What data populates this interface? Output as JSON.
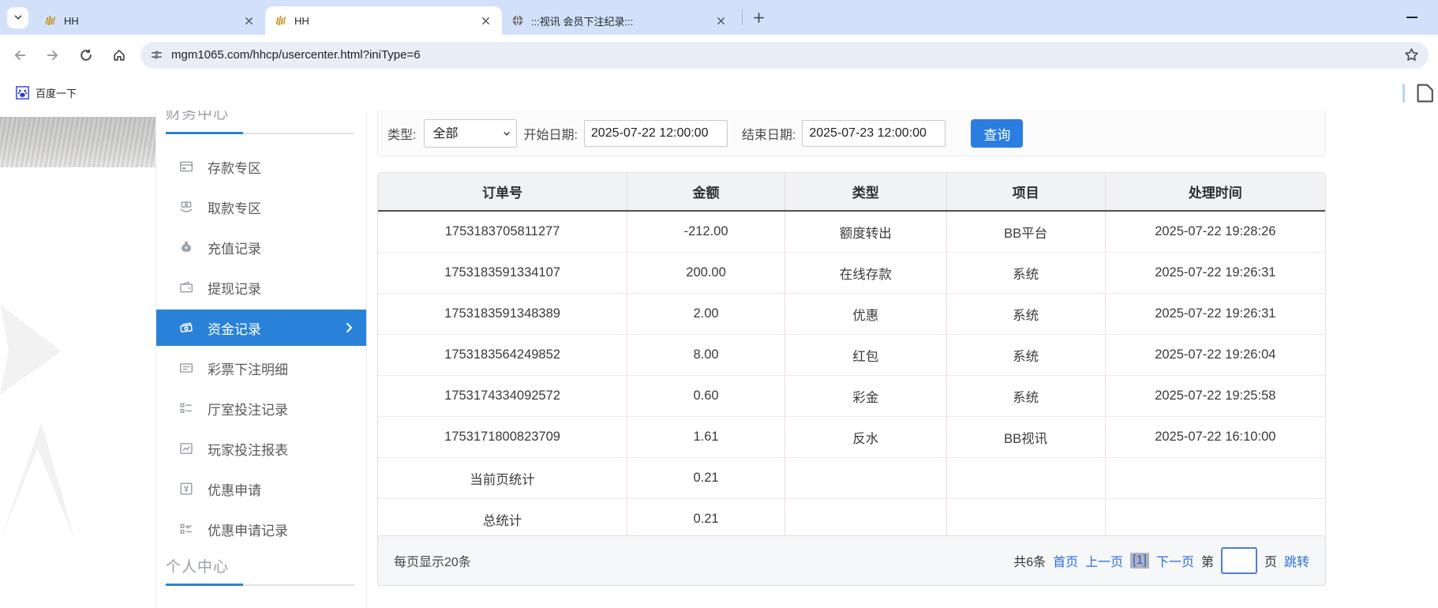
{
  "browser": {
    "tabs": [
      {
        "title": "HH",
        "favicon": "hh-gold-bars-logo"
      },
      {
        "title": "HH",
        "favicon": "hh-gold-bars-logo",
        "active": true
      },
      {
        "title": ":::视讯 会员下注纪录:::",
        "favicon": "globe"
      }
    ],
    "url": "mgm1065.com/hhcp/usercenter.html?iniType=6",
    "bookmarks": [
      {
        "label": "百度一下",
        "icon": "baidu-paw"
      }
    ]
  },
  "icons": {
    "tab_search": "chevron-down",
    "new_tab": "plus",
    "window": "minimize-dash",
    "toolbar": [
      "back-arrow",
      "forward-arrow",
      "reload",
      "home",
      "site-info-tune",
      "bookmark-star"
    ]
  },
  "sidebar": {
    "section_finance": "财务中心",
    "section_personal": "个人中心",
    "items": [
      {
        "label": "存款专区",
        "icon": "deposit-card"
      },
      {
        "label": "取款专区",
        "icon": "withdraw-hand"
      },
      {
        "label": "充值记录",
        "icon": "recharge-moneybag"
      },
      {
        "label": "提现记录",
        "icon": "withdrawal-wallet"
      },
      {
        "label": "资金记录",
        "icon": "funds-banknotes",
        "active": true
      },
      {
        "label": "彩票下注明细",
        "icon": "lottery-list"
      },
      {
        "label": "厅室投注记录",
        "icon": "hall-bet-list"
      },
      {
        "label": "玩家投注报表",
        "icon": "player-report-chart"
      },
      {
        "label": "优惠申请",
        "icon": "promo-apply"
      },
      {
        "label": "优惠申请记录",
        "icon": "promo-record-list"
      }
    ]
  },
  "filters": {
    "type_label": "类型:",
    "type_value": "全部",
    "start_label": "开始日期:",
    "start_value": "2025-07-22 12:00:00",
    "end_label": "结束日期:",
    "end_value": "2025-07-23 12:00:00",
    "search_button": "查询"
  },
  "table": {
    "headers": [
      "订单号",
      "金额",
      "类型",
      "项目",
      "处理时间"
    ],
    "rows": [
      [
        "1753183705811277",
        "-212.00",
        "额度转出",
        "BB平台",
        "2025-07-22 19:28:26"
      ],
      [
        "1753183591334107",
        "200.00",
        "在线存款",
        "系统",
        "2025-07-22 19:26:31"
      ],
      [
        "1753183591348389",
        "2.00",
        "优惠",
        "系统",
        "2025-07-22 19:26:31"
      ],
      [
        "1753183564249852",
        "8.00",
        "红包",
        "系统",
        "2025-07-22 19:26:04"
      ],
      [
        "1753174334092572",
        "0.60",
        "彩金",
        "系统",
        "2025-07-22 19:25:58"
      ],
      [
        "1753171800823709",
        "1.61",
        "反水",
        "BB视讯",
        "2025-07-22 16:10:00"
      ],
      [
        "当前页统计",
        "0.21",
        "",
        "",
        ""
      ],
      [
        "总统计",
        "0.21",
        "",
        "",
        ""
      ]
    ]
  },
  "pagination": {
    "page_size_text": "每页显示20条",
    "total_text": "共6条",
    "first": "首页",
    "prev": "上一页",
    "current": "[1]",
    "next": "下一页",
    "jump_prefix": "第",
    "jump_suffix": "页",
    "jump_button": "跳转",
    "jump_value": ""
  },
  "colors": {
    "tabstrip_bg": "#d2e1f9",
    "accent_blue": "#2a82d8",
    "button_blue": "#2b7de2",
    "link_blue": "#2a6edb",
    "table_header_bg": "#f0f2f5",
    "table_border_pink": "#f1dcdc",
    "pager_bg": "#f6f7f9"
  }
}
